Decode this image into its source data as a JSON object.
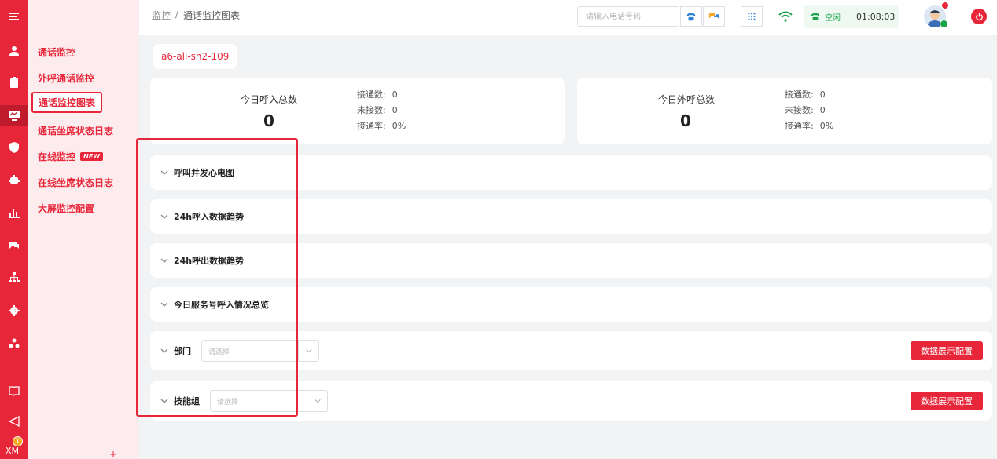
{
  "rail": {
    "colors": {
      "bg": "#e8263a",
      "active": "#c01b2d"
    },
    "items": [
      {
        "icon": "menu-icon"
      },
      {
        "icon": "user-icon"
      },
      {
        "icon": "clipboard-icon"
      },
      {
        "icon": "monitor-icon"
      },
      {
        "icon": "shield-icon"
      },
      {
        "icon": "robot-icon"
      },
      {
        "icon": "bar-chart-icon"
      },
      {
        "icon": "chat-icon"
      },
      {
        "icon": "org-tree-icon"
      },
      {
        "icon": "gear-icon"
      },
      {
        "icon": "users-icon"
      },
      {
        "icon": "book-icon"
      },
      {
        "icon": "send-icon"
      }
    ],
    "badge": {
      "count": "1",
      "label": "XM"
    }
  },
  "submenu": {
    "items": [
      {
        "label": "通话监控"
      },
      {
        "label": "外呼通话监控"
      },
      {
        "label": "通话监控图表",
        "active": true
      },
      {
        "label": "通话坐席状态日志"
      },
      {
        "label": "在线监控",
        "badge": "NEW"
      },
      {
        "label": "在线坐席状态日志"
      },
      {
        "label": "大屏监控配置"
      }
    ],
    "plus": "+"
  },
  "topbar": {
    "breadcrumb": {
      "root": "监控",
      "sep": "/",
      "current": "通话监控图表"
    },
    "phone_placeholder": "请输入电话号码",
    "status": {
      "label": "空闲",
      "time": "01:08:03",
      "color": "#1aa34a"
    }
  },
  "main": {
    "tag": "a6-ali-sh2-109",
    "inbound": {
      "title": "今日呼入总数",
      "value": "0",
      "rows": [
        {
          "label": "接通数:",
          "value": "0"
        },
        {
          "label": "未接数:",
          "value": "0"
        },
        {
          "label": "接通率:",
          "value": "0%"
        }
      ]
    },
    "outbound": {
      "title": "今日外呼总数",
      "value": "0",
      "rows": [
        {
          "label": "接通数:",
          "value": "0"
        },
        {
          "label": "未接数:",
          "value": "0"
        },
        {
          "label": "接通率:",
          "value": "0%"
        }
      ]
    },
    "panels": [
      {
        "title": "呼叫并发心电图"
      },
      {
        "title": "24h呼入数据趋势"
      },
      {
        "title": "24h呼出数据趋势"
      },
      {
        "title": "今日服务号呼入情况总览"
      }
    ],
    "dept_panel": {
      "title": "部门",
      "placeholder": "请选择",
      "button": "数据展示配置"
    },
    "skill_panel": {
      "title": "技能组",
      "placeholder": "请选择",
      "button": "数据展示配置"
    }
  }
}
